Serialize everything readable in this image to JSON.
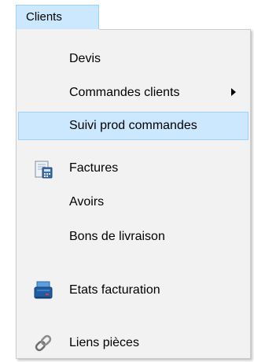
{
  "menubar": {
    "label": "Clients"
  },
  "menu": {
    "items": [
      {
        "label": "Devis",
        "icon": null
      },
      {
        "label": "Commandes clients",
        "icon": null,
        "submenu": true
      },
      {
        "label": "Suivi prod commandes",
        "icon": null,
        "selected": true
      },
      {
        "label": "Factures",
        "icon": "invoice-calculator-icon"
      },
      {
        "label": "Avoirs",
        "icon": null
      },
      {
        "label": "Bons de livraison",
        "icon": null
      },
      {
        "label": "Etats facturation",
        "icon": "printer-icon"
      },
      {
        "label": "Liens pièces",
        "icon": "chain-link-icon"
      }
    ]
  },
  "colors": {
    "highlight_bg": "#cce8ff",
    "highlight_border": "#99d1ff",
    "menu_bg": "#f2f2f2"
  }
}
